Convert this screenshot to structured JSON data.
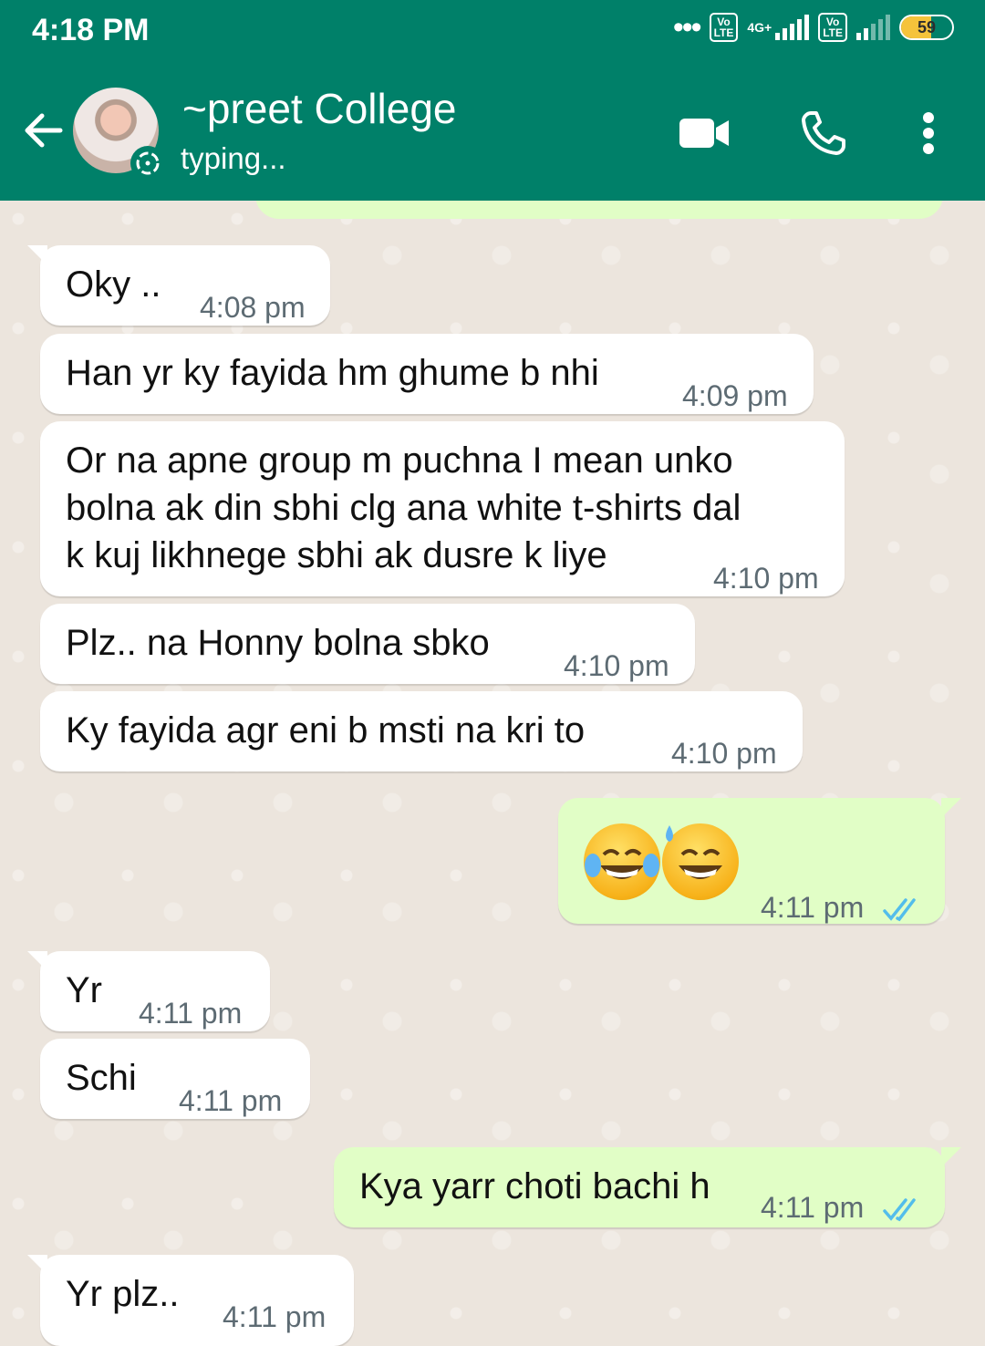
{
  "status_bar": {
    "time": "4:18 PM",
    "overflow_dots": "•••",
    "volte1": "Vo\nLTE",
    "network": "4G+",
    "volte2": "Vo\nLTE",
    "battery": "59",
    "battery_level_fraction": 0.59
  },
  "header": {
    "contact_name": "~preet College",
    "status": "typing..."
  },
  "icons": {
    "back": "back-arrow-icon",
    "video": "video-call-icon",
    "call": "phone-icon",
    "menu": "more-vert-icon",
    "read": "double-check-icon"
  },
  "colors": {
    "header": "#008069",
    "incoming": "#ffffff",
    "outgoing": "#e1fec6",
    "read_ticks": "#53bdeb"
  },
  "messages": [
    {
      "dir": "in",
      "text": "Oky ..",
      "time": "4:08 pm"
    },
    {
      "dir": "in",
      "text": "Han yr ky fayida hm ghume b nhi",
      "time": "4:09 pm"
    },
    {
      "dir": "in",
      "text": "Or na apne group m puchna I mean unko\nbolna ak din sbhi clg ana white t-shirts dal\nk kuj likhnege sbhi ak dusre k liye",
      "time": "4:10 pm"
    },
    {
      "dir": "in",
      "text": "Plz.. na Honny bolna sbko",
      "time": "4:10 pm"
    },
    {
      "dir": "in",
      "text": "Ky fayida agr eni b msti na kri to",
      "time": "4:10 pm"
    },
    {
      "dir": "out",
      "text": "😂😅",
      "time": "4:11 pm"
    },
    {
      "dir": "in",
      "text": "Yr",
      "time": "4:11 pm"
    },
    {
      "dir": "in",
      "text": "Schi",
      "time": "4:11 pm"
    },
    {
      "dir": "out",
      "text": "Kya yarr choti bachi h",
      "time": "4:11 pm"
    },
    {
      "dir": "in",
      "text": "Yr plz..",
      "time": "4:11 pm"
    }
  ]
}
